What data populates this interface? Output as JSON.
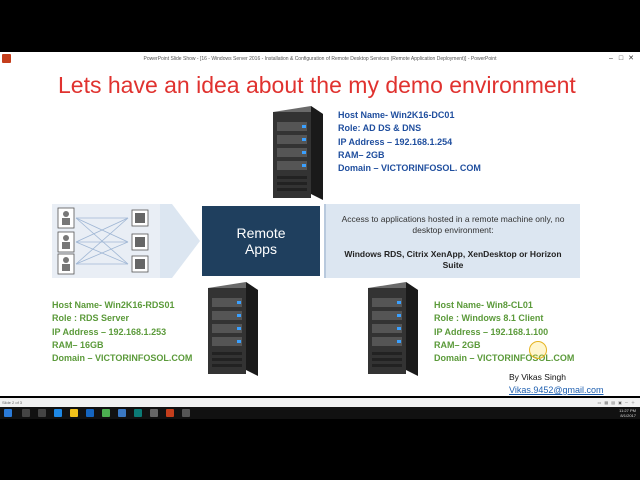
{
  "window": {
    "title": "PowerPoint Slide Show - [16 - Windows Server 2016 - Installation & Configuration of Remote Desktop Services (Remote Application Deployment)] - PowerPoint"
  },
  "slide": {
    "title": "Lets have an idea about the my demo environment",
    "dc": {
      "host": "Host Name- Win2K16-DC01",
      "role": "Role: AD DS & DNS",
      "ip": "IP Address – 192.168.1.254",
      "ram": "RAM– 2GB",
      "domain": "Domain – VICTORINFOSOL. COM"
    },
    "rds": {
      "host": "Host Name- Win2K16-RDS01",
      "role": "Role : RDS Server",
      "ip": "IP Address – 192.168.1.253",
      "ram": "RAM– 16GB",
      "domain": "Domain – VICTORINFOSOL.COM"
    },
    "client": {
      "host": "Host Name- Win8-CL01",
      "role": "Role : Windows 8.1 Client",
      "ip": "IP Address – 192.168.1.100",
      "ram": "RAM– 2GB",
      "domain": "Domain – VICTORINFOSOL.COM"
    },
    "remote_apps": {
      "line1": "Remote",
      "line2": "Apps"
    },
    "access": {
      "description": "Access to applications hosted in a remote machine only, no desktop environment:",
      "products": "Windows RDS, Citrix XenApp, XenDesktop or Horizon Suite"
    },
    "author": "By Vikas Singh",
    "email": "Vikas.9452@gmail.com"
  },
  "statusbar": {
    "slide_info": "Slide 2 of 3"
  },
  "taskbar": {
    "time": "11:27 PM",
    "date": "8/1/2017"
  },
  "colors": {
    "title": "#e0322f",
    "blue_text": "#1f4e9e",
    "green_text": "#5b9a3a",
    "remote_box": "#1f3f5e",
    "access_box": "#dce6f1"
  }
}
